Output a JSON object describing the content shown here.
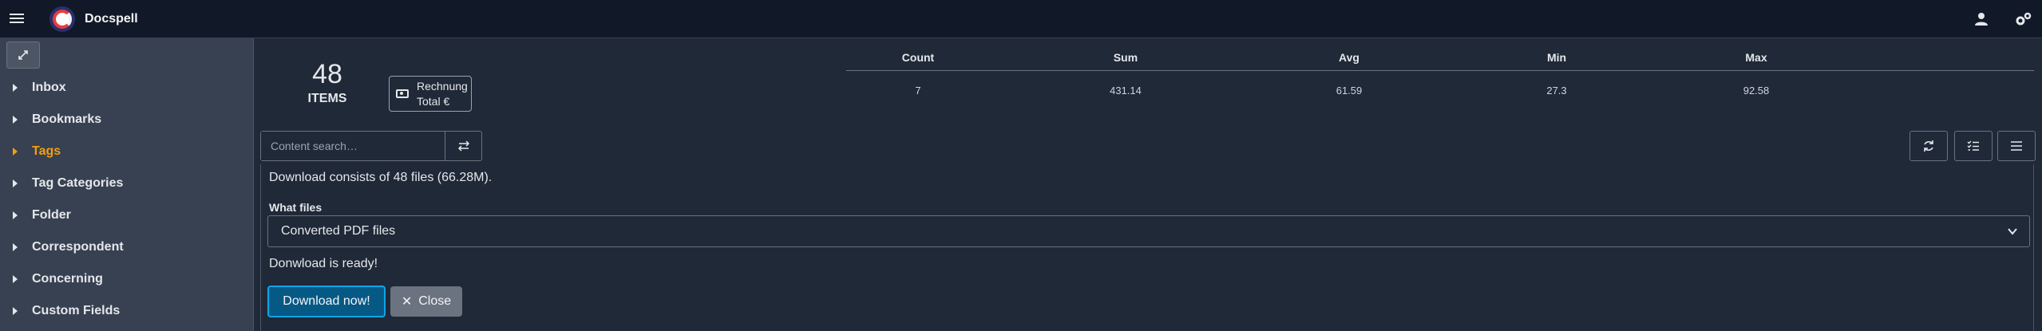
{
  "header": {
    "app_title": "Docspell",
    "menu_icon": "hamburger-icon",
    "user_icon": "user-icon",
    "settings_icon": "cogs-icon"
  },
  "sidebar": {
    "expand_icon": "expand-arrows-icon",
    "items": [
      {
        "label": "Inbox",
        "active": false
      },
      {
        "label": "Bookmarks",
        "active": false
      },
      {
        "label": "Tags",
        "active": true
      },
      {
        "label": "Tag Categories",
        "active": false
      },
      {
        "label": "Folder",
        "active": false
      },
      {
        "label": "Correspondent",
        "active": false
      },
      {
        "label": "Concerning",
        "active": false
      },
      {
        "label": "Custom Fields",
        "active": false
      }
    ]
  },
  "stats": {
    "count": "48",
    "count_label": "ITEMS",
    "field_badge": {
      "line1": "Rechnung",
      "line2": "Total €",
      "icon": "money-bill-icon"
    },
    "columns": [
      "Count",
      "Sum",
      "Avg",
      "Min",
      "Max"
    ],
    "values": [
      "7",
      "431.14",
      "61.59",
      "27.3",
      "92.58"
    ]
  },
  "search": {
    "placeholder": "Content search…",
    "swap_icon": "exchange-icon"
  },
  "toolbar_icons": [
    "sync-icon",
    "list-check-icon",
    "bars-icon"
  ],
  "download": {
    "info": "Download consists of 48 files (66.28M).",
    "what_files_label": "What files",
    "selected_option": "Converted PDF files",
    "ready_text": "Donwload is ready!",
    "download_button": "Download now!",
    "close_button": "Close"
  },
  "colors": {
    "background": "#1f2937",
    "sidebar": "#374151",
    "topbar": "#111827",
    "active_accent": "#f59e0b",
    "primary_button": "#075985"
  }
}
